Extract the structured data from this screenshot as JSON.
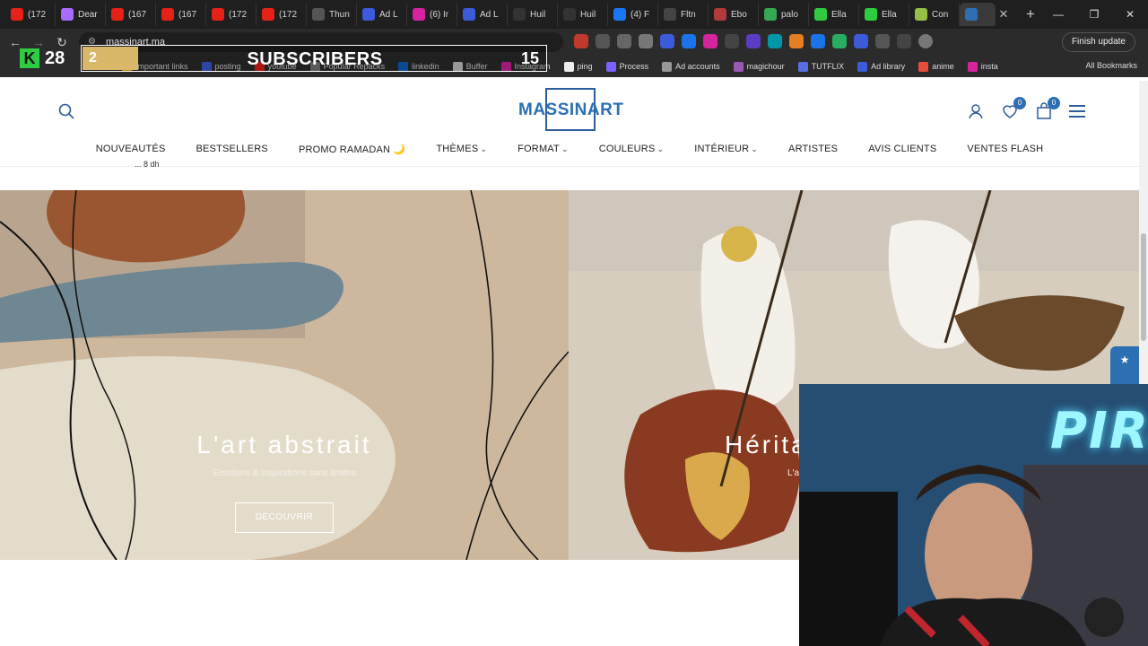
{
  "browser": {
    "tabs": [
      {
        "label": "(172",
        "color": "#e62117"
      },
      {
        "label": "Dear",
        "color": "#a56cff"
      },
      {
        "label": "(167",
        "color": "#e62117"
      },
      {
        "label": "(167",
        "color": "#e62117"
      },
      {
        "label": "(172",
        "color": "#e62117"
      },
      {
        "label": "(172",
        "color": "#e62117"
      },
      {
        "label": "Thun",
        "color": "#555555"
      },
      {
        "label": "Ad L",
        "color": "#3b5bdb"
      },
      {
        "label": "(6) Ir",
        "color": "#d6249f"
      },
      {
        "label": "Ad L",
        "color": "#3b5bdb"
      },
      {
        "label": "Huil",
        "color": "#333333"
      },
      {
        "label": "Huil",
        "color": "#333333"
      },
      {
        "label": "(4) F",
        "color": "#1877f2"
      },
      {
        "label": "Fltn",
        "color": "#444444"
      },
      {
        "label": "Ebo",
        "color": "#b23a3a"
      },
      {
        "label": "palo",
        "color": "#34a853"
      },
      {
        "label": "Ella",
        "color": "#2ecc40"
      },
      {
        "label": "Ella",
        "color": "#2ecc40"
      },
      {
        "label": "Con",
        "color": "#95bf47"
      }
    ],
    "url": "massinart.ma",
    "finish_update": "Finish update",
    "bookmarks": [
      {
        "label": "Important links",
        "color": "#f4b400"
      },
      {
        "label": "posting",
        "color": "#3b5bdb"
      },
      {
        "label": "youtube",
        "color": "#e62117"
      },
      {
        "label": "Popular Repacks",
        "color": "#777777"
      },
      {
        "label": "linkedin",
        "color": "#0a66c2"
      },
      {
        "label": "Buffer",
        "color": "#cccccc"
      },
      {
        "label": "Instagram",
        "color": "#d6249f"
      },
      {
        "label": "ping",
        "color": "#eeeeee"
      },
      {
        "label": "Process",
        "color": "#7b61ff"
      },
      {
        "label": "Ad accounts",
        "color": "#999999"
      },
      {
        "label": "magichour",
        "color": "#9b59b6"
      },
      {
        "label": "TUTFLIX",
        "color": "#5b6ee1"
      },
      {
        "label": "Ad library",
        "color": "#3b5bdb"
      },
      {
        "label": "anime",
        "color": "#e74c3c"
      },
      {
        "label": "insta",
        "color": "#d6249f"
      }
    ],
    "all_bookmarks": "All Bookmarks"
  },
  "subscriber_overlay": {
    "icon_letter": "K",
    "count": "28",
    "progress_left": "2",
    "label": "SUBSCRIBERS",
    "goal": "15",
    "progress_fraction": 0.12
  },
  "site": {
    "logo": "MASSINART",
    "wishlist_count": "0",
    "cart_count": "0",
    "nav": [
      {
        "label": "NOUVEAUTÉS",
        "dropdown": false
      },
      {
        "label": "BESTSELLERS",
        "dropdown": false
      },
      {
        "label": "PROMO RAMADAN 🌙",
        "dropdown": false
      },
      {
        "label": "THÈMES",
        "dropdown": true
      },
      {
        "label": "FORMAT",
        "dropdown": true
      },
      {
        "label": "COULEURS",
        "dropdown": true
      },
      {
        "label": "INTÉRIEUR",
        "dropdown": true
      },
      {
        "label": "ARTISTES",
        "dropdown": false
      },
      {
        "label": "AVIS CLIENTS",
        "dropdown": false
      },
      {
        "label": "VENTES FLASH",
        "dropdown": false
      }
    ],
    "partial_price": "... 8 dh"
  },
  "panels": {
    "left": {
      "title": "L'art abstrait",
      "subtitle": "Emotions & inspirations sans limites",
      "button": "DÉCOUVRIR"
    },
    "right": {
      "title": "Hérita",
      "subtitle": "L'a"
    }
  },
  "side_tab": "★",
  "webcam": {
    "neon_text": "PIRL"
  },
  "colors": {
    "brand": "#2c6fb2",
    "chrome_dark": "#1f1f1f"
  }
}
